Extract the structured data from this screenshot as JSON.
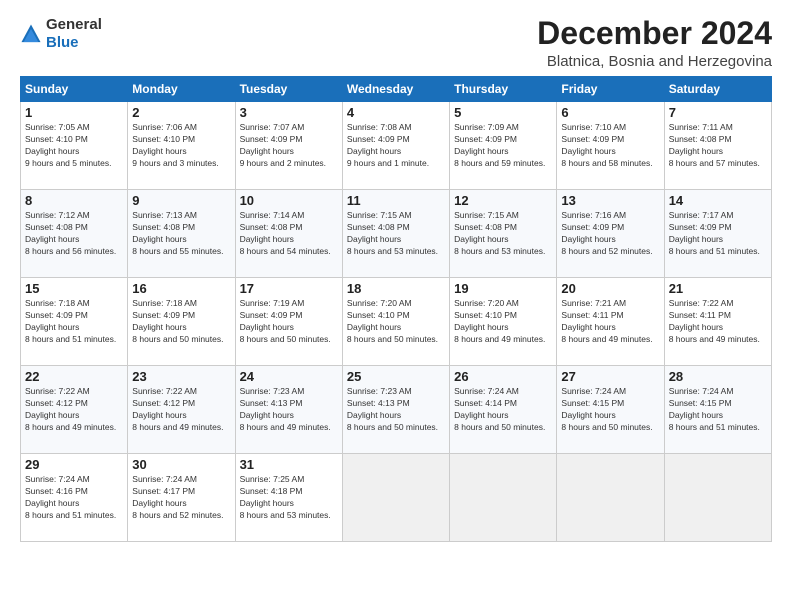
{
  "header": {
    "logo_general": "General",
    "logo_blue": "Blue",
    "month": "December 2024",
    "location": "Blatnica, Bosnia and Herzegovina"
  },
  "columns": [
    "Sunday",
    "Monday",
    "Tuesday",
    "Wednesday",
    "Thursday",
    "Friday",
    "Saturday"
  ],
  "weeks": [
    [
      {
        "day": "1",
        "sunrise": "7:05 AM",
        "sunset": "4:10 PM",
        "daylight": "9 hours and 5 minutes."
      },
      {
        "day": "2",
        "sunrise": "7:06 AM",
        "sunset": "4:10 PM",
        "daylight": "9 hours and 3 minutes."
      },
      {
        "day": "3",
        "sunrise": "7:07 AM",
        "sunset": "4:09 PM",
        "daylight": "9 hours and 2 minutes."
      },
      {
        "day": "4",
        "sunrise": "7:08 AM",
        "sunset": "4:09 PM",
        "daylight": "9 hours and 1 minute."
      },
      {
        "day": "5",
        "sunrise": "7:09 AM",
        "sunset": "4:09 PM",
        "daylight": "8 hours and 59 minutes."
      },
      {
        "day": "6",
        "sunrise": "7:10 AM",
        "sunset": "4:09 PM",
        "daylight": "8 hours and 58 minutes."
      },
      {
        "day": "7",
        "sunrise": "7:11 AM",
        "sunset": "4:08 PM",
        "daylight": "8 hours and 57 minutes."
      }
    ],
    [
      {
        "day": "8",
        "sunrise": "7:12 AM",
        "sunset": "4:08 PM",
        "daylight": "8 hours and 56 minutes."
      },
      {
        "day": "9",
        "sunrise": "7:13 AM",
        "sunset": "4:08 PM",
        "daylight": "8 hours and 55 minutes."
      },
      {
        "day": "10",
        "sunrise": "7:14 AM",
        "sunset": "4:08 PM",
        "daylight": "8 hours and 54 minutes."
      },
      {
        "day": "11",
        "sunrise": "7:15 AM",
        "sunset": "4:08 PM",
        "daylight": "8 hours and 53 minutes."
      },
      {
        "day": "12",
        "sunrise": "7:15 AM",
        "sunset": "4:08 PM",
        "daylight": "8 hours and 53 minutes."
      },
      {
        "day": "13",
        "sunrise": "7:16 AM",
        "sunset": "4:09 PM",
        "daylight": "8 hours and 52 minutes."
      },
      {
        "day": "14",
        "sunrise": "7:17 AM",
        "sunset": "4:09 PM",
        "daylight": "8 hours and 51 minutes."
      }
    ],
    [
      {
        "day": "15",
        "sunrise": "7:18 AM",
        "sunset": "4:09 PM",
        "daylight": "8 hours and 51 minutes."
      },
      {
        "day": "16",
        "sunrise": "7:18 AM",
        "sunset": "4:09 PM",
        "daylight": "8 hours and 50 minutes."
      },
      {
        "day": "17",
        "sunrise": "7:19 AM",
        "sunset": "4:09 PM",
        "daylight": "8 hours and 50 minutes."
      },
      {
        "day": "18",
        "sunrise": "7:20 AM",
        "sunset": "4:10 PM",
        "daylight": "8 hours and 50 minutes."
      },
      {
        "day": "19",
        "sunrise": "7:20 AM",
        "sunset": "4:10 PM",
        "daylight": "8 hours and 49 minutes."
      },
      {
        "day": "20",
        "sunrise": "7:21 AM",
        "sunset": "4:11 PM",
        "daylight": "8 hours and 49 minutes."
      },
      {
        "day": "21",
        "sunrise": "7:22 AM",
        "sunset": "4:11 PM",
        "daylight": "8 hours and 49 minutes."
      }
    ],
    [
      {
        "day": "22",
        "sunrise": "7:22 AM",
        "sunset": "4:12 PM",
        "daylight": "8 hours and 49 minutes."
      },
      {
        "day": "23",
        "sunrise": "7:22 AM",
        "sunset": "4:12 PM",
        "daylight": "8 hours and 49 minutes."
      },
      {
        "day": "24",
        "sunrise": "7:23 AM",
        "sunset": "4:13 PM",
        "daylight": "8 hours and 49 minutes."
      },
      {
        "day": "25",
        "sunrise": "7:23 AM",
        "sunset": "4:13 PM",
        "daylight": "8 hours and 50 minutes."
      },
      {
        "day": "26",
        "sunrise": "7:24 AM",
        "sunset": "4:14 PM",
        "daylight": "8 hours and 50 minutes."
      },
      {
        "day": "27",
        "sunrise": "7:24 AM",
        "sunset": "4:15 PM",
        "daylight": "8 hours and 50 minutes."
      },
      {
        "day": "28",
        "sunrise": "7:24 AM",
        "sunset": "4:15 PM",
        "daylight": "8 hours and 51 minutes."
      }
    ],
    [
      {
        "day": "29",
        "sunrise": "7:24 AM",
        "sunset": "4:16 PM",
        "daylight": "8 hours and 51 minutes."
      },
      {
        "day": "30",
        "sunrise": "7:24 AM",
        "sunset": "4:17 PM",
        "daylight": "8 hours and 52 minutes."
      },
      {
        "day": "31",
        "sunrise": "7:25 AM",
        "sunset": "4:18 PM",
        "daylight": "8 hours and 53 minutes."
      },
      null,
      null,
      null,
      null
    ]
  ]
}
